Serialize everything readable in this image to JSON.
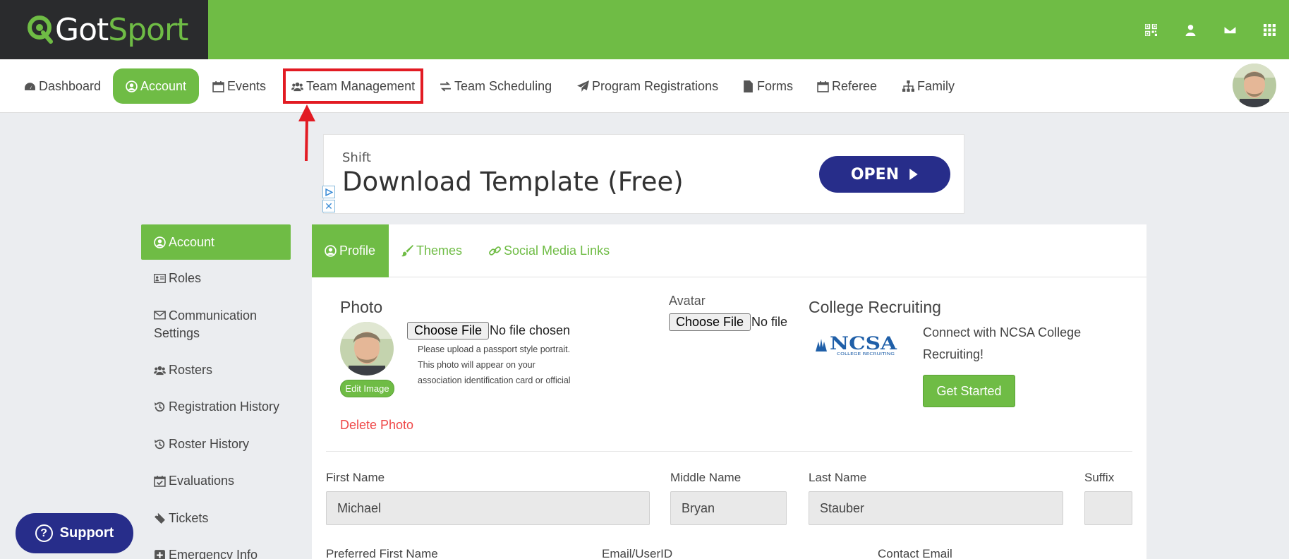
{
  "brand": {
    "logo_got": "Got",
    "logo_sport": "Sport"
  },
  "header_icons": [
    "qr-code-icon",
    "user-icon",
    "envelope-icon",
    "grid-icon"
  ],
  "nav": {
    "items": [
      {
        "label": "Dashboard",
        "icon": "dashboard-icon"
      },
      {
        "label": "Account",
        "icon": "user-circle-icon",
        "active": true
      },
      {
        "label": "Events",
        "icon": "calendar-icon"
      },
      {
        "label": "Team Management",
        "icon": "users-icon",
        "highlighted": true
      },
      {
        "label": "Team Scheduling",
        "icon": "exchange-icon"
      },
      {
        "label": "Program Registrations",
        "icon": "paper-plane-icon"
      },
      {
        "label": "Forms",
        "icon": "file-icon"
      },
      {
        "label": "Referee",
        "icon": "calendar-icon"
      },
      {
        "label": "Family",
        "icon": "sitemap-icon"
      }
    ]
  },
  "ad": {
    "brand": "Shift",
    "headline": "Download Template (Free)",
    "cta": "OPEN"
  },
  "sidebar": {
    "items": [
      {
        "label": "Account",
        "icon": "user-circle-icon",
        "active": true
      },
      {
        "label": "Roles",
        "icon": "id-card-icon"
      },
      {
        "label": "Communication Settings",
        "icon": "envelope-icon"
      },
      {
        "label": "Rosters",
        "icon": "users-icon"
      },
      {
        "label": "Registration History",
        "icon": "history-icon"
      },
      {
        "label": "Roster History",
        "icon": "history-icon"
      },
      {
        "label": "Evaluations",
        "icon": "calendar-check-icon"
      },
      {
        "label": "Tickets",
        "icon": "ticket-icon"
      },
      {
        "label": "Emergency Info",
        "icon": "plus-square-icon"
      }
    ]
  },
  "support": {
    "label": "Support",
    "glyph": "?"
  },
  "tabs": [
    {
      "label": "Profile",
      "icon": "user-circle-icon",
      "active": true
    },
    {
      "label": "Themes",
      "icon": "paint-brush-icon"
    },
    {
      "label": "Social Media Links",
      "icon": "link-icon"
    }
  ],
  "photo": {
    "heading": "Photo",
    "choose_file": "Choose File",
    "no_file": "No file chosen",
    "help": "Please upload a passport style portrait. This photo will appear on your association identification card or official roster.",
    "edit_image": "Edit Image",
    "delete_photo": "Delete Photo"
  },
  "avatar": {
    "heading": "Avatar",
    "choose_file": "Choose File",
    "no_file": "No file chosen"
  },
  "college": {
    "heading": "College Recruiting",
    "ncsa_logo": "NCSA",
    "ncsa_sub": "COLLEGE RECRUITING",
    "text": "Connect with NCSA College Recruiting!",
    "button": "Get Started"
  },
  "fields": {
    "first_name": {
      "label": "First Name",
      "value": "Michael"
    },
    "middle_name": {
      "label": "Middle Name",
      "value": "Bryan"
    },
    "last_name": {
      "label": "Last Name",
      "value": "Stauber"
    },
    "suffix": {
      "label": "Suffix",
      "value": ""
    },
    "preferred_first_name": {
      "label": "Preferred First Name"
    },
    "email": {
      "label": "Email/UserID"
    },
    "contact_email": {
      "label": "Contact Email"
    }
  },
  "colors": {
    "brand_green": "#6fbc45",
    "dark": "#2a2b2d",
    "navy": "#272d8a",
    "highlight_red": "#e21b23",
    "danger": "#ef4848"
  }
}
